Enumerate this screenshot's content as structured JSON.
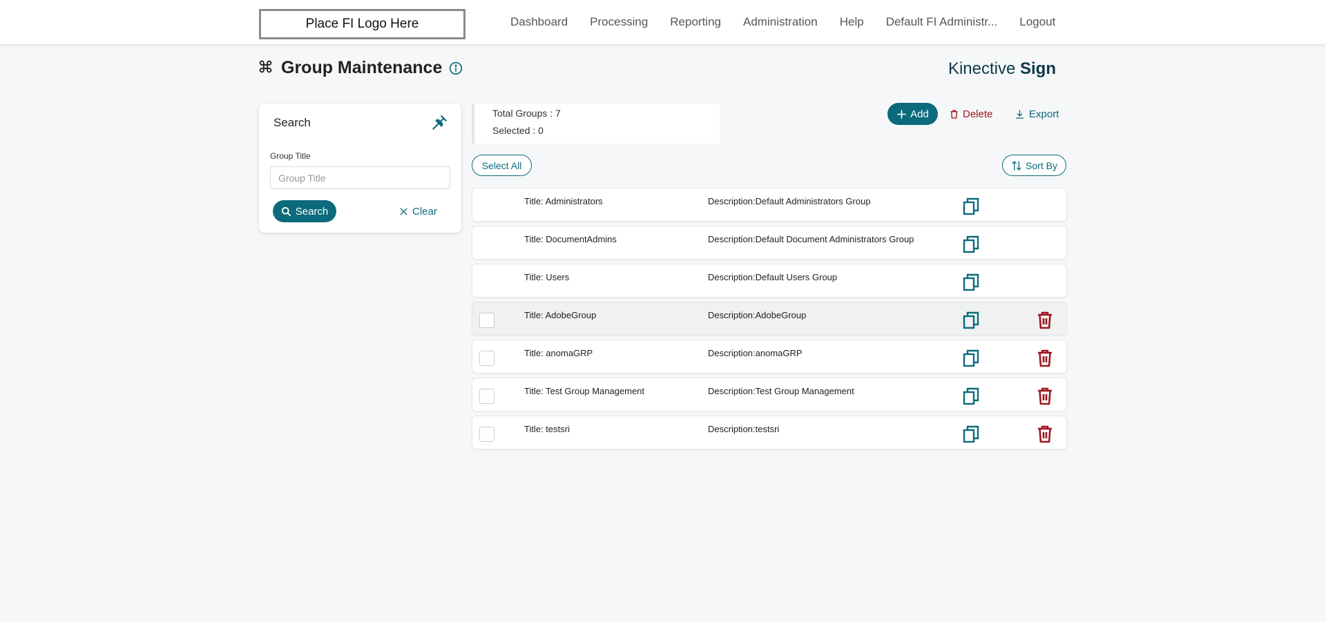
{
  "header": {
    "logo_text": "Place FI Logo Here",
    "nav": [
      "Dashboard",
      "Processing",
      "Reporting",
      "Administration",
      "Help",
      "Default FI Administr...",
      "Logout"
    ]
  },
  "page": {
    "title": "Group Maintenance",
    "brand_light": "Kinective",
    "brand_bold": "Sign"
  },
  "search": {
    "heading": "Search",
    "field_label": "Group Title",
    "field_placeholder": "Group Title",
    "field_value": "",
    "search_label": "Search",
    "clear_label": "Clear"
  },
  "summary": {
    "total": "Total Groups : 7",
    "selected": "Selected : 0"
  },
  "actions": {
    "add": "Add",
    "delete": "Delete",
    "export": "Export",
    "select_all": "Select All",
    "sort_by": "Sort By"
  },
  "groups": [
    {
      "title": "Title: Administrators",
      "description": "Description:Default Administrators Group"
    },
    {
      "title": "Title: DocumentAdmins",
      "description": "Description:Default Document Administrators Group"
    },
    {
      "title": "Title: Users",
      "description": "Description:Default Users Group"
    },
    {
      "title": "Title: AdobeGroup",
      "description": "Description:AdobeGroup"
    },
    {
      "title": "Title: anomaGRP",
      "description": "Description:anomaGRP"
    },
    {
      "title": "Title: Test Group Management",
      "description": "Description:Test Group Management"
    },
    {
      "title": "Title: testsri",
      "description": "Description:testsri"
    }
  ],
  "colors": {
    "primary": "#0b6a7b",
    "danger": "#a0151e",
    "background": "#f5f7f8"
  },
  "icons": {
    "title": "command-icon",
    "info": "info-icon",
    "pin": "pin-icon",
    "copy": "copy-icon",
    "trash": "trash-icon"
  }
}
